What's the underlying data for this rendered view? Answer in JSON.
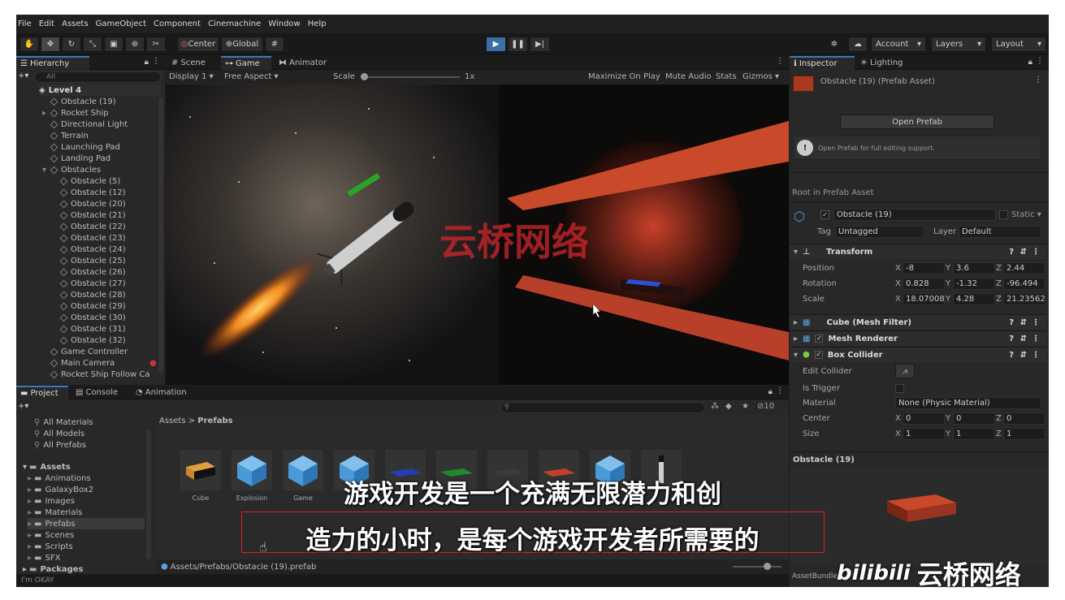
{
  "menu": [
    "File",
    "Edit",
    "Assets",
    "GameObject",
    "Component",
    "Cinemachine",
    "Window",
    "Help"
  ],
  "toolbar": {
    "center_label": "Center",
    "global_label": "Global",
    "account_label": "Account",
    "layers_label": "Layers",
    "layout_label": "Layout"
  },
  "hierarchy": {
    "tab": "Hierarchy",
    "search_placeholder": "All",
    "scene": "Level 4",
    "items": [
      {
        "label": "Obstacle (19)",
        "indent": 1
      },
      {
        "label": "Rocket Ship",
        "indent": 1
      },
      {
        "label": "Directional Light",
        "indent": 1
      },
      {
        "label": "Terrain",
        "indent": 1
      },
      {
        "label": "Launching Pad",
        "indent": 1
      },
      {
        "label": "Landing Pad",
        "indent": 1
      },
      {
        "label": "Obstacles",
        "indent": 1
      },
      {
        "label": "Obstacle (5)",
        "indent": 2
      },
      {
        "label": "Obstacle (12)",
        "indent": 2
      },
      {
        "label": "Obstacle (20)",
        "indent": 2
      },
      {
        "label": "Obstacle (21)",
        "indent": 2
      },
      {
        "label": "Obstacle (22)",
        "indent": 2
      },
      {
        "label": "Obstacle (23)",
        "indent": 2
      },
      {
        "label": "Obstacle (24)",
        "indent": 2
      },
      {
        "label": "Obstacle (25)",
        "indent": 2
      },
      {
        "label": "Obstacle (26)",
        "indent": 2
      },
      {
        "label": "Obstacle (27)",
        "indent": 2
      },
      {
        "label": "Obstacle (28)",
        "indent": 2
      },
      {
        "label": "Obstacle (29)",
        "indent": 2
      },
      {
        "label": "Obstacle (30)",
        "indent": 2
      },
      {
        "label": "Obstacle (31)",
        "indent": 2
      },
      {
        "label": "Obstacle (32)",
        "indent": 2
      },
      {
        "label": "Game Controller",
        "indent": 1
      },
      {
        "label": "Main Camera",
        "indent": 1
      },
      {
        "label": "Rocket Ship Follow Ca",
        "indent": 1
      }
    ]
  },
  "scene_tabs": [
    "Scene",
    "Game",
    "Animator"
  ],
  "game_bar": {
    "display": "Display 1",
    "aspect": "Free Aspect",
    "scale_label": "Scale",
    "scale_value": "1x",
    "maximize": "Maximize On Play",
    "mute": "Mute Audio",
    "stats": "Stats",
    "gizmos": "Gizmos"
  },
  "watermark": "云桥网络",
  "inspector": {
    "tabs": [
      "Inspector",
      "Lighting"
    ],
    "asset_title": "Obstacle (19) (Prefab Asset)",
    "open_prefab": "Open Prefab",
    "help_text": "Open Prefab for full editing support.",
    "root_label": "Root in Prefab Asset",
    "name": "Obstacle (19)",
    "static": "Static",
    "tag_label": "Tag",
    "tag": "Untagged",
    "layer_label": "Layer",
    "layer": "Default",
    "transform": "Transform",
    "position_label": "Position",
    "rotation_label": "Rotation",
    "scale_label": "Scale",
    "position": [
      "-8",
      "3.6",
      "2.44"
    ],
    "rotation": [
      "0.828",
      "-1.32",
      "-96.494"
    ],
    "scale": [
      "18.07008",
      "4.28",
      "21.23562"
    ],
    "axis": [
      "X",
      "Y",
      "Z"
    ],
    "mesh_filter": "Cube (Mesh Filter)",
    "mesh_renderer": "Mesh Renderer",
    "box_collider": "Box Collider",
    "edit_collider": "Edit Collider",
    "is_trigger": "Is Trigger",
    "material_label": "Material",
    "material": "None (Physic Material)",
    "center_label": "Center",
    "center": [
      "0",
      "0",
      "0"
    ],
    "size_label": "Size",
    "size": [
      "1",
      "1",
      "1"
    ],
    "preview_title": "Obstacle (19)",
    "assetbundle": "AssetBundle"
  },
  "project": {
    "tabs": [
      "Project",
      "Console",
      "Animation"
    ],
    "favorites": [
      "All Materials",
      "All Models",
      "All Prefabs"
    ],
    "assets_root": "Assets",
    "folders": [
      "Animations",
      "GalaxyBox2",
      "Images",
      "Materials",
      "Prefabs",
      "Scenes",
      "Scripts",
      "SFX"
    ],
    "packages": "Packages",
    "breadcrumb_root": "Assets",
    "breadcrumb_leaf": "Prefabs",
    "count": "10",
    "asset_labels": [
      "Cube",
      "Explosion",
      "Game",
      "",
      "",
      "",
      "",
      "",
      "",
      ""
    ],
    "path": "Assets/Prefabs/Obstacle (19).prefab"
  },
  "status": "I'm OKAY",
  "subtitles": [
    "游戏开发是一个充满无限潜力和创",
    "造力的小时，是每个游戏开发者所需要的"
  ],
  "brand": {
    "logo": "bilibili",
    "name": "云桥网络"
  }
}
